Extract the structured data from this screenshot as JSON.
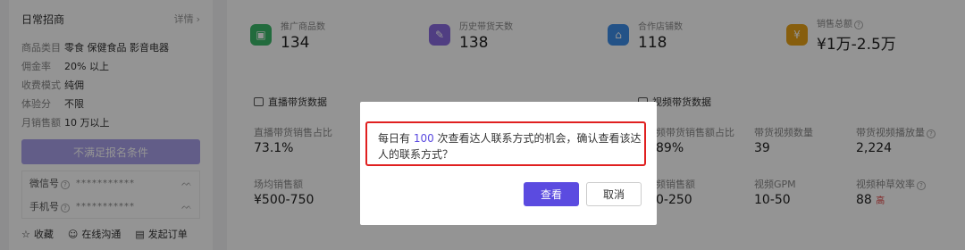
{
  "left": {
    "title": "日常招商",
    "detail": "详情",
    "rows": [
      {
        "k": "商品类目",
        "v": "零食 保健食品 影音电器"
      },
      {
        "k": "佣金率",
        "v": "20% 以上"
      },
      {
        "k": "收费模式",
        "v": "纯佣"
      },
      {
        "k": "体验分",
        "v": "不限"
      },
      {
        "k": "月销售额",
        "v": "10 万以上"
      }
    ],
    "disabled_btn": "不满足报名条件",
    "wechat_label": "微信号",
    "phone_label": "手机号",
    "masked": "***********",
    "actions": {
      "collect": "收藏",
      "chat": "在线沟通",
      "order": "发起订单"
    }
  },
  "stats": [
    {
      "label": "推广商品数",
      "value": "134",
      "color": "#3bb86a",
      "icon": "shop-icon"
    },
    {
      "label": "历史带货天数",
      "value": "138",
      "color": "#8a6be0",
      "icon": "calendar-icon"
    },
    {
      "label": "合作店铺数",
      "value": "118",
      "color": "#3d8de8",
      "icon": "store-icon"
    },
    {
      "label": "销售总额",
      "value": "¥1万-2.5万",
      "color": "#e8a317",
      "icon": "money-icon"
    }
  ],
  "sections": {
    "live": "直播带货数据",
    "video": "视频带货数据"
  },
  "metrics": {
    "live_ratio_label": "直播带货销售占比",
    "live_ratio_value": "73.1%",
    "live_sales_label": "场均销售额",
    "live_sales_value": "¥500-750",
    "video_ratio_label": "频带货销售额占比",
    "video_ratio_value": "89%",
    "video_sales_label": "频销售额",
    "video_sales_value": "0-250",
    "video_count_label": "带货视频数量",
    "video_count_value": "39",
    "video_gpm_label": "视频GPM",
    "video_gpm_value": "10-50",
    "video_plays_label": "带货视频播放量",
    "video_plays_value": "2,224",
    "video_eff_label": "视频种草效率",
    "video_eff_value": "88",
    "video_eff_tag": "高"
  },
  "dialog": {
    "message": "每日有 100 次查看达人联系方式的机会，确认查看该达人的联系方式？",
    "count": "100",
    "ok": "查看",
    "cancel": "取消"
  }
}
